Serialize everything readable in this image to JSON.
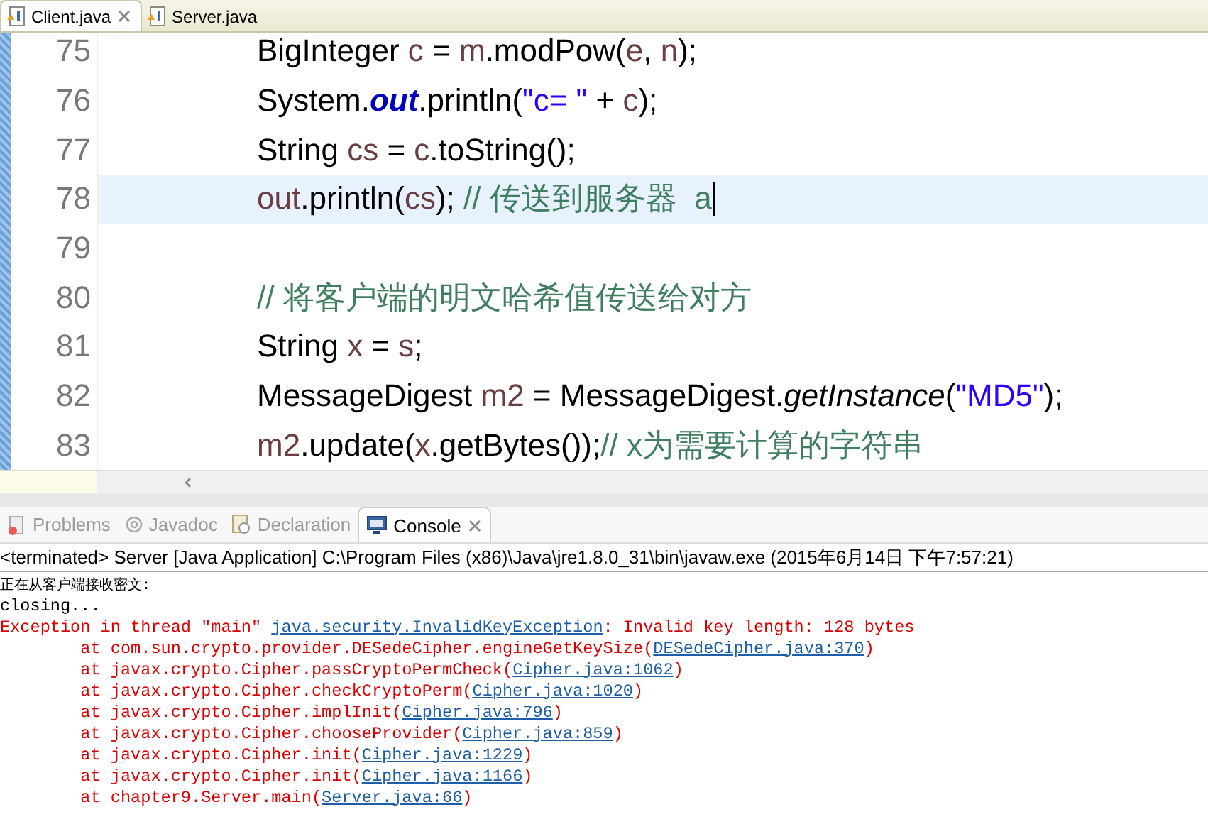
{
  "editor_tabs": [
    {
      "label": "Client.java",
      "selected": true
    },
    {
      "label": "Server.java",
      "selected": false
    }
  ],
  "code_lines": [
    {
      "number": "75",
      "current": false,
      "tokens": [
        {
          "kind": "plain",
          "text": "BigInteger "
        },
        {
          "kind": "var",
          "text": "c"
        },
        {
          "kind": "plain",
          "text": " = "
        },
        {
          "kind": "var",
          "text": "m"
        },
        {
          "kind": "plain",
          "text": ".modPow("
        },
        {
          "kind": "var",
          "text": "e"
        },
        {
          "kind": "plain",
          "text": ", "
        },
        {
          "kind": "var",
          "text": "n"
        },
        {
          "kind": "plain",
          "text": ");"
        }
      ]
    },
    {
      "number": "76",
      "current": false,
      "tokens": [
        {
          "kind": "plain",
          "text": "System."
        },
        {
          "kind": "field",
          "text": "out"
        },
        {
          "kind": "plain",
          "text": ".println("
        },
        {
          "kind": "string",
          "text": "\"c= \""
        },
        {
          "kind": "plain",
          "text": " + "
        },
        {
          "kind": "var",
          "text": "c"
        },
        {
          "kind": "plain",
          "text": ");"
        }
      ]
    },
    {
      "number": "77",
      "current": false,
      "tokens": [
        {
          "kind": "plain",
          "text": "String "
        },
        {
          "kind": "var",
          "text": "cs"
        },
        {
          "kind": "plain",
          "text": " = "
        },
        {
          "kind": "var",
          "text": "c"
        },
        {
          "kind": "plain",
          "text": ".toString();"
        }
      ]
    },
    {
      "number": "78",
      "current": true,
      "tokens": [
        {
          "kind": "var",
          "text": "out"
        },
        {
          "kind": "plain",
          "text": ".println("
        },
        {
          "kind": "var",
          "text": "cs"
        },
        {
          "kind": "plain",
          "text": "); "
        },
        {
          "kind": "comment",
          "text": "// 传送到服务器  a"
        }
      ]
    },
    {
      "number": "79",
      "current": false
    },
    {
      "number": "80",
      "current": false,
      "tokens": [
        {
          "kind": "comment",
          "text": "// 将客户端的明文哈希值传送给对方"
        }
      ]
    },
    {
      "number": "81",
      "current": false,
      "tokens": [
        {
          "kind": "plain",
          "text": "String "
        },
        {
          "kind": "var",
          "text": "x"
        },
        {
          "kind": "plain",
          "text": " = "
        },
        {
          "kind": "var",
          "text": "s"
        },
        {
          "kind": "plain",
          "text": ";"
        }
      ]
    },
    {
      "number": "82",
      "current": false,
      "tokens": [
        {
          "kind": "plain",
          "text": "MessageDigest "
        },
        {
          "kind": "var",
          "text": "m2"
        },
        {
          "kind": "plain",
          "text": " = MessageDigest."
        },
        {
          "kind": "static",
          "text": "getInstance"
        },
        {
          "kind": "plain",
          "text": "("
        },
        {
          "kind": "string",
          "text": "\"MD5\""
        },
        {
          "kind": "plain",
          "text": ");"
        }
      ]
    },
    {
      "number": "83",
      "current": false,
      "tokens": [
        {
          "kind": "var",
          "text": "m2"
        },
        {
          "kind": "plain",
          "text": ".update("
        },
        {
          "kind": "var",
          "text": "x"
        },
        {
          "kind": "plain",
          "text": ".getBytes());"
        },
        {
          "kind": "comment",
          "text": "// x为需要计算的字符串"
        }
      ]
    }
  ],
  "view_tabs": [
    {
      "label": "Problems",
      "selected": false
    },
    {
      "label": "Javadoc",
      "selected": false
    },
    {
      "label": "Declaration",
      "selected": false
    },
    {
      "label": "Console",
      "selected": true
    }
  ],
  "console": {
    "header": "<terminated> Server [Java Application] C:\\Program Files (x86)\\Java\\jre1.8.0_31\\bin\\javaw.exe (2015年6月14日 下午7:57:21)",
    "lines": [
      {
        "kind": "small",
        "parts": [
          {
            "text": "正在从客户端接收密文:",
            "link": false
          }
        ]
      },
      {
        "kind": "plain",
        "parts": [
          {
            "text": "closing...",
            "link": false
          }
        ]
      },
      {
        "kind": "error",
        "parts": [
          {
            "text": "Exception in thread \"main\" ",
            "link": false
          },
          {
            "text": "java.security.InvalidKeyException",
            "link": true
          },
          {
            "text": ": Invalid key length: 128 bytes",
            "link": false
          }
        ]
      },
      {
        "kind": "error",
        "parts": [
          {
            "text": "\tat com.sun.crypto.provider.DESedeCipher.engineGetKeySize(",
            "link": false
          },
          {
            "text": "DESedeCipher.java:370",
            "link": true
          },
          {
            "text": ")",
            "link": false
          }
        ]
      },
      {
        "kind": "error",
        "parts": [
          {
            "text": "\tat javax.crypto.Cipher.passCryptoPermCheck(",
            "link": false
          },
          {
            "text": "Cipher.java:1062",
            "link": true
          },
          {
            "text": ")",
            "link": false
          }
        ]
      },
      {
        "kind": "error",
        "parts": [
          {
            "text": "\tat javax.crypto.Cipher.checkCryptoPerm(",
            "link": false
          },
          {
            "text": "Cipher.java:1020",
            "link": true
          },
          {
            "text": ")",
            "link": false
          }
        ]
      },
      {
        "kind": "error",
        "parts": [
          {
            "text": "\tat javax.crypto.Cipher.implInit(",
            "link": false
          },
          {
            "text": "Cipher.java:796",
            "link": true
          },
          {
            "text": ")",
            "link": false
          }
        ]
      },
      {
        "kind": "error",
        "parts": [
          {
            "text": "\tat javax.crypto.Cipher.chooseProvider(",
            "link": false
          },
          {
            "text": "Cipher.java:859",
            "link": true
          },
          {
            "text": ")",
            "link": false
          }
        ]
      },
      {
        "kind": "error",
        "parts": [
          {
            "text": "\tat javax.crypto.Cipher.init(",
            "link": false
          },
          {
            "text": "Cipher.java:1229",
            "link": true
          },
          {
            "text": ")",
            "link": false
          }
        ]
      },
      {
        "kind": "error",
        "parts": [
          {
            "text": "\tat javax.crypto.Cipher.init(",
            "link": false
          },
          {
            "text": "Cipher.java:1166",
            "link": true
          },
          {
            "text": ")",
            "link": false
          }
        ]
      },
      {
        "kind": "error",
        "parts": [
          {
            "text": "\tat chapter9.Server.main(",
            "link": false
          },
          {
            "text": "Server.java:66",
            "link": true
          },
          {
            "text": ")",
            "link": false
          }
        ]
      }
    ]
  }
}
